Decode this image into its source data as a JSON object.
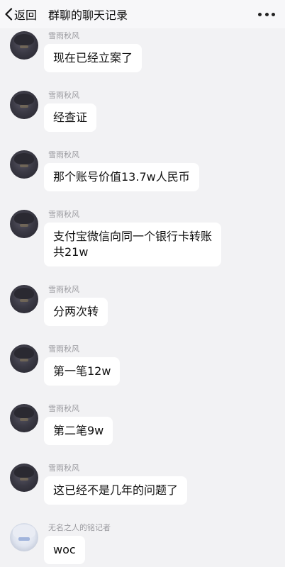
{
  "header": {
    "back_label": "返回",
    "title": "群聊的聊天记录"
  },
  "messages": [
    {
      "sender": "雪雨秋风",
      "lines": [
        "现在已经立案了"
      ]
    },
    {
      "sender": "雪雨秋风",
      "lines": [
        "经查证"
      ]
    },
    {
      "sender": "雪雨秋风",
      "lines": [
        "那个账号价值13.7w人民币"
      ]
    },
    {
      "sender": "雪雨秋风",
      "lines": [
        "支付宝微信向同一个银行卡转账",
        "共21w"
      ]
    },
    {
      "sender": "雪雨秋风",
      "lines": [
        "分两次转"
      ]
    },
    {
      "sender": "雪雨秋风",
      "lines": [
        "第一笔12w"
      ]
    },
    {
      "sender": "雪雨秋风",
      "lines": [
        "第二笔9w"
      ]
    },
    {
      "sender": "雪雨秋风",
      "lines": [
        "这已经不是几年的问题了"
      ]
    },
    {
      "sender": "无名之人的铭记者",
      "lines": [
        "woc"
      ]
    }
  ]
}
